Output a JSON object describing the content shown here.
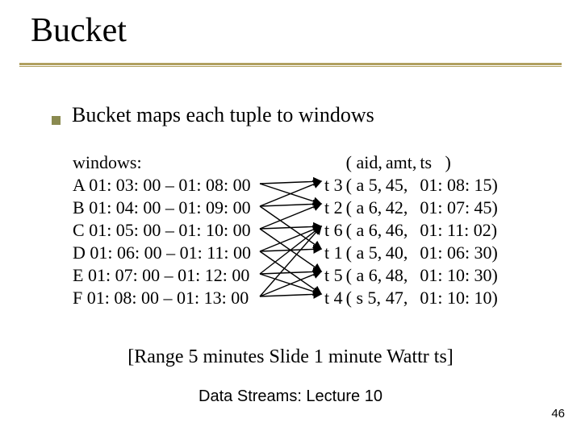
{
  "title": "Bucket",
  "bullet": "Bucket maps each tuple to windows",
  "windows_label": "windows:",
  "windows": [
    {
      "name": "A",
      "range": "01: 03: 00 – 01: 08: 00"
    },
    {
      "name": "B",
      "range": "01: 04: 00 – 01: 09: 00"
    },
    {
      "name": "C",
      "range": "01: 05: 00 – 01: 10: 00"
    },
    {
      "name": "D",
      "range": "01: 06: 00 – 01: 11: 00"
    },
    {
      "name": "E",
      "range": "01: 07: 00 – 01: 12: 00"
    },
    {
      "name": "F",
      "range": "01: 08: 00 – 01: 13: 00"
    }
  ],
  "tuple_header": {
    "c1": "",
    "c2": "( aid,",
    "c3": "amt,",
    "c4": "ts   )"
  },
  "tuples": [
    {
      "c1": "t 3",
      "c2": "( a 5,",
      "c3": "45,",
      "c4": "01: 08: 15)"
    },
    {
      "c1": "t 2",
      "c2": "( a 6,",
      "c3": "42,",
      "c4": "01: 07: 45)"
    },
    {
      "c1": "t 6",
      "c2": "( a 6,",
      "c3": "46,",
      "c4": "01: 11: 02)"
    },
    {
      "c1": "t 1",
      "c2": "( a 5,",
      "c3": "40,",
      "c4": "01: 06: 30)"
    },
    {
      "c1": "t 5",
      "c2": "( a 6,",
      "c3": "48,",
      "c4": "01: 10: 30)"
    },
    {
      "c1": "t 4",
      "c2": "( s 5,",
      "c3": "47,",
      "c4": "01: 10: 10)"
    }
  ],
  "range_line": "[Range 5 minutes  Slide 1 minute  Wattr ts]",
  "footer_center": "Data Streams: Lecture 10",
  "page_number": "46"
}
